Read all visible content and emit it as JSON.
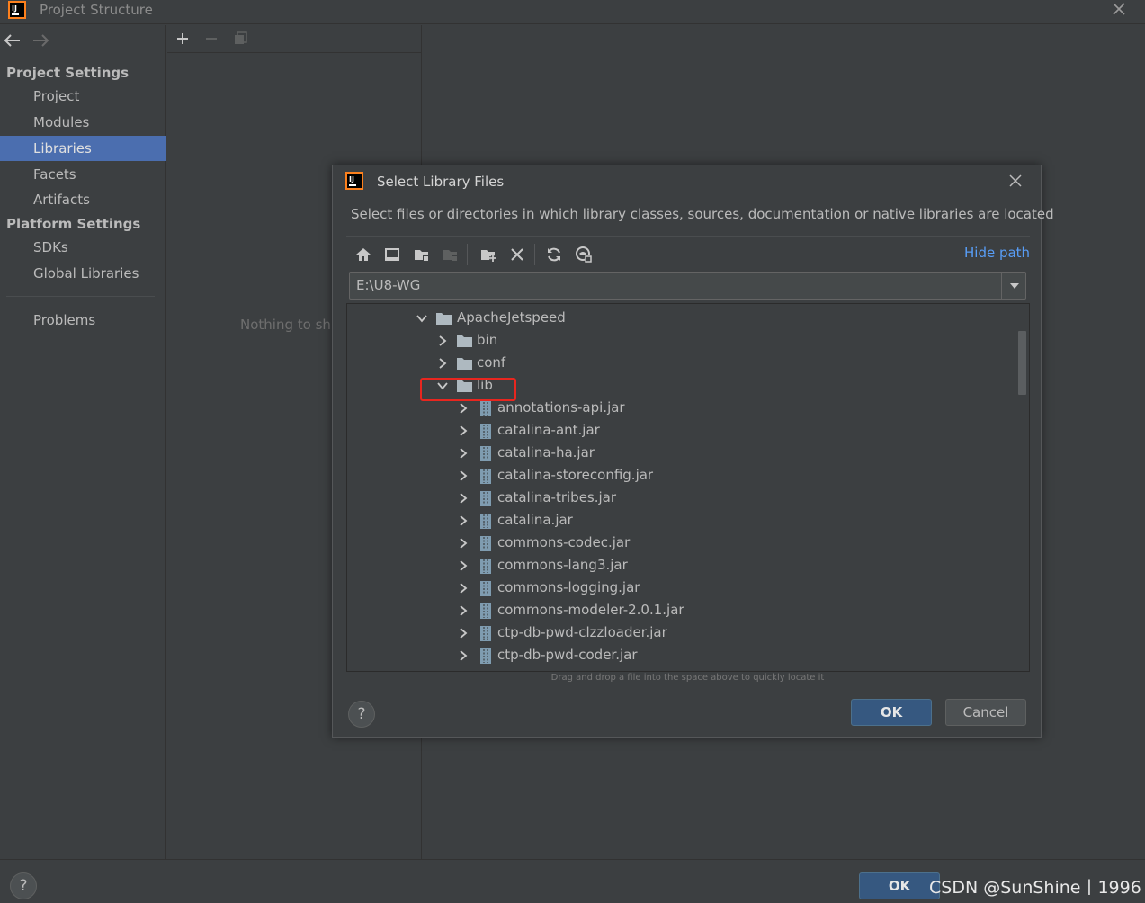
{
  "window": {
    "title": "Project Structure"
  },
  "sidebar": {
    "project_settings_header": "Project Settings",
    "project_items": [
      {
        "label": "Project"
      },
      {
        "label": "Modules"
      },
      {
        "label": "Libraries",
        "selected": true
      },
      {
        "label": "Facets"
      },
      {
        "label": "Artifacts"
      }
    ],
    "platform_settings_header": "Platform Settings",
    "platform_items": [
      {
        "label": "SDKs"
      },
      {
        "label": "Global Libraries"
      }
    ],
    "problems_label": "Problems"
  },
  "middle_panel": {
    "empty_text": "Nothing to sh"
  },
  "dialog": {
    "title": "Select Library Files",
    "description": "Select files or directories in which library classes, sources, documentation or native libraries are located",
    "hide_path_label": "Hide path",
    "path_value": "E:\\U8-WG",
    "tree": [
      {
        "label": "ApacheJetspeed",
        "type": "folder",
        "expanded": true,
        "level": 0
      },
      {
        "label": "bin",
        "type": "folder",
        "expanded": false,
        "level": 1
      },
      {
        "label": "conf",
        "type": "folder",
        "expanded": false,
        "level": 1
      },
      {
        "label": "lib",
        "type": "folder",
        "expanded": true,
        "level": 1
      },
      {
        "label": "annotations-api.jar",
        "type": "jar",
        "level": 2
      },
      {
        "label": "catalina-ant.jar",
        "type": "jar",
        "level": 2
      },
      {
        "label": "catalina-ha.jar",
        "type": "jar",
        "level": 2
      },
      {
        "label": "catalina-storeconfig.jar",
        "type": "jar",
        "level": 2
      },
      {
        "label": "catalina-tribes.jar",
        "type": "jar",
        "level": 2
      },
      {
        "label": "catalina.jar",
        "type": "jar",
        "level": 2
      },
      {
        "label": "commons-codec.jar",
        "type": "jar",
        "level": 2
      },
      {
        "label": "commons-lang3.jar",
        "type": "jar",
        "level": 2
      },
      {
        "label": "commons-logging.jar",
        "type": "jar",
        "level": 2
      },
      {
        "label": "commons-modeler-2.0.1.jar",
        "type": "jar",
        "level": 2
      },
      {
        "label": "ctp-db-pwd-clzzloader.jar",
        "type": "jar",
        "level": 2
      },
      {
        "label": "ctp-db-pwd-coder.jar",
        "type": "jar",
        "level": 2
      }
    ],
    "hint": "Drag and drop a file into the space above to quickly locate it",
    "ok_label": "OK",
    "cancel_label": "Cancel"
  },
  "bottom": {
    "ok_label": "OK",
    "watermark": "CSDN @SunShine丨1996"
  },
  "colors": {
    "background": "#3c3f41",
    "selection": "#4b6eaf",
    "link": "#589df6",
    "primary_button": "#365880",
    "highlight_box": "#e8261f"
  }
}
